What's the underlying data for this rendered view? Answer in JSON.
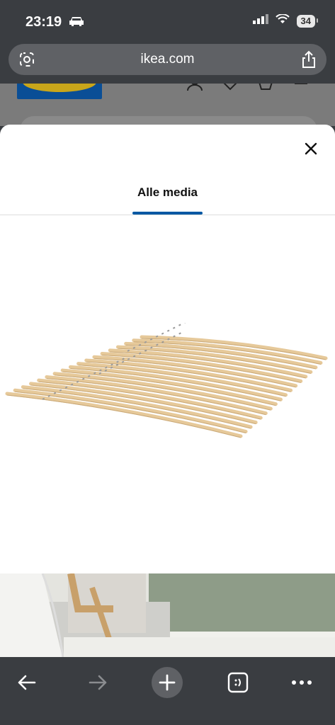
{
  "status_bar": {
    "time": "23:19",
    "battery": "34"
  },
  "browser": {
    "url": "ikea.com"
  },
  "modal": {
    "tab_label": "Alle media"
  },
  "colors": {
    "accent": "#0058a3",
    "ikea_blue": "#0058a3",
    "ikea_yellow": "#ffdb00"
  },
  "icons": {
    "status": [
      "car-icon",
      "signal-icon",
      "wifi-icon",
      "battery-icon"
    ],
    "toolbar": [
      "back-arrow-icon",
      "forward-arrow-icon",
      "plus-icon",
      "tabs-icon",
      "more-icon"
    ]
  }
}
